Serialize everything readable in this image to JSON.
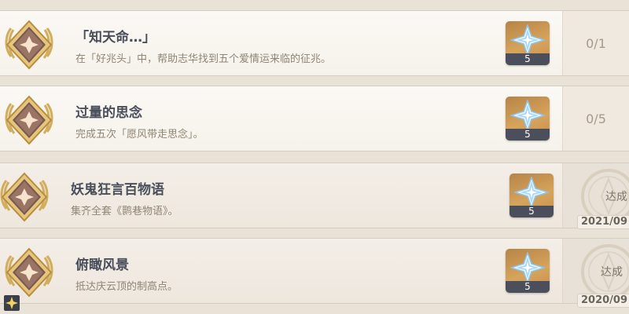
{
  "achievements": [
    {
      "title": "「知天命…」",
      "description": "在「好兆头」中，帮助志华找到五个爱情运来临的征兆。",
      "reward_count": "5",
      "progress": "0/1"
    },
    {
      "title": "过量的思念",
      "description": "完成五次「愿风带走思念」。",
      "reward_count": "5",
      "progress": "0/5"
    },
    {
      "title": "妖鬼狂言百物语",
      "description": "集齐全套《鹮巷物语》。",
      "reward_count": "5",
      "status": "达成",
      "date": "2021/09"
    },
    {
      "title": "俯瞰风景",
      "description": "抵达庆云顶的制高点。",
      "reward_count": "5",
      "status": "达成",
      "date": "2020/09"
    }
  ],
  "icons": {
    "badge": "gold-laurel-badge-icon",
    "reward": "primogem-icon",
    "seal": "achievement-seal-icon",
    "corner": "sparkle-icon"
  },
  "colors": {
    "background": "#e9e2d6",
    "title": "#494e5a",
    "description": "#8f8575",
    "reward_tile": "#d7a45c",
    "progress": "#a49a8c"
  }
}
